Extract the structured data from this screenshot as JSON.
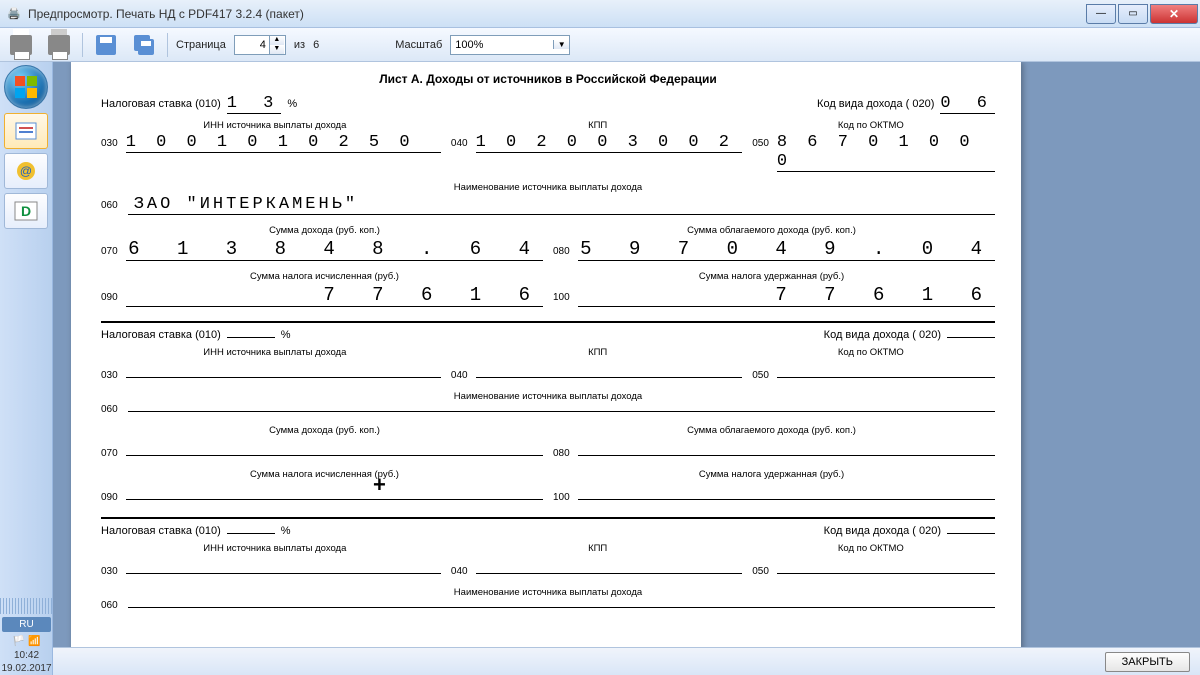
{
  "window": {
    "title": "Предпросмотр. Печать НД с PDF417 3.2.4 (пакет)"
  },
  "toolbar": {
    "page_label": "Страница",
    "page_value": "4",
    "of_label": "из",
    "total_pages": "6",
    "zoom_label": "Масштаб",
    "zoom_value": "100%"
  },
  "form": {
    "sheet_title": "Лист А. Доходы от источников в Российской Федерации",
    "rate_label": "Налоговая ставка (010)",
    "rate_value": "1 3",
    "percent": "%",
    "income_code_label": "Код вида дохода ( 020)",
    "income_code_value": "0 6",
    "hdr_inn": "ИНН источника выплаты дохода",
    "hdr_kpp": "КПП",
    "hdr_oktmo": "Код по ОКТМО",
    "c030": "030",
    "c040": "040",
    "c050": "050",
    "c060": "060",
    "c070": "070",
    "c080": "080",
    "c090": "090",
    "c100": "100",
    "inn_value": "1 0 0 1 0 1 0 2 5 0",
    "kpp_value": "1 0 2 0 0 3 0 0 2",
    "oktmo_value": "8 6 7 0 1 0 0 0",
    "src_name_label": "Наименование источника выплаты дохода",
    "src_name_value": "ЗАО \"ИНТЕРКАМЕНЬ\"",
    "sum_income_label": "Сумма дохода (руб. коп.)",
    "sum_taxable_label": "Сумма облагаемого дохода (руб. коп.)",
    "sum_income_value": "6 1 3 8 4 8 . 6 4",
    "sum_taxable_value": "5 9 7 0 4 9 . 0 4",
    "tax_calc_label": "Сумма налога исчисленная (руб.)",
    "tax_withheld_label": "Сумма налога удержанная (руб.)",
    "tax_calc_value": "7 7 6 1 6",
    "tax_withheld_value": "7 7 6 1 6"
  },
  "footer": {
    "close_label": "ЗАКРЫТЬ"
  },
  "tray": {
    "lang": "RU",
    "time": "10:42",
    "date": "19.02.2017"
  }
}
